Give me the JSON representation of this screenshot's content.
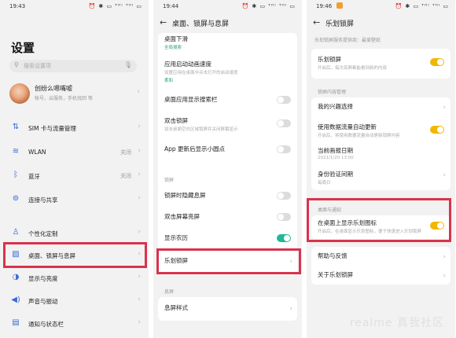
{
  "panel1": {
    "time": "19:43",
    "status_icons": "⏰ ✱ ▭ ᵀᴴᴵ ᵀᴴᴵ ▭",
    "title": "设置",
    "search_placeholder": "搜索设置项",
    "profile": {
      "name": "创纷么嗯嘴嘘",
      "sub": "帐号，云服务，手机找回 等"
    },
    "rows": [
      {
        "label": "SIM 卡与流量管理",
        "value": ""
      },
      {
        "label": "WLAN",
        "value": "关闭"
      },
      {
        "label": "蓝牙",
        "value": "关闭"
      },
      {
        "label": "连接与共享",
        "value": ""
      },
      {
        "label": "个性化定制",
        "value": ""
      },
      {
        "label": "桌面、锁屏与息屏",
        "value": ""
      },
      {
        "label": "显示与亮度",
        "value": ""
      },
      {
        "label": "声音与振动",
        "value": ""
      },
      {
        "label": "通知与状态栏",
        "value": ""
      }
    ]
  },
  "panel2": {
    "time": "19:44",
    "status_icons": "⏰ ✱ ▭ ᵀᴴᴵ ᵀᴴᴵ ▭",
    "nav_title": "桌面、锁屏与息屏",
    "items_top": [
      {
        "title": "桌面下滑",
        "desc": "全局搜索"
      },
      {
        "title": "应用启动动画速度",
        "desc": "设置应用在桌面中点击打开的启动速度",
        "value": "柔和"
      },
      {
        "title": "桌面应用显示搜索栏",
        "desc": ""
      },
      {
        "title": "双击锁屏",
        "desc": "双击桌面空白区域锁屏并关闭屏幕显示"
      },
      {
        "title": "App 更新后显示小圆点",
        "desc": ""
      }
    ],
    "section_lock": "锁屏",
    "items_lock": [
      {
        "title": "锁屏时隐藏息屏"
      },
      {
        "title": "双击屏幕亮屏"
      },
      {
        "title": "显示农历"
      },
      {
        "title": "乐划锁屏"
      }
    ],
    "section_aod": "息屏",
    "items_aod": [
      {
        "title": "息屏样式"
      }
    ]
  },
  "panel3": {
    "time": "19:46",
    "status_icons": "⏰ ✱ ▭ ᵀᴴᴵ ᵀᴴᴵ ▭",
    "nav_title": "乐划锁屏",
    "intro": "乐划锁屏服务提供商：最爱壁纸",
    "item_main": {
      "title": "乐划锁屏",
      "desc": "开启后，每次亮屏都能看到新的内容"
    },
    "section_content": "锁屏内容管理",
    "items_content": [
      {
        "title": "我的兴趣选择",
        "desc": ""
      },
      {
        "title": "使用数据流量自动更新",
        "desc": "开启后，将使用数据流量自动更新锁屏内容"
      },
      {
        "title": "当前画报日期",
        "desc": "2021/1/20 13:00"
      },
      {
        "title": "身份验证间期",
        "desc": "每周日"
      }
    ],
    "section_desktop": "桌面与通知",
    "item_desktop": {
      "title": "在桌面上显示乐划图标",
      "desc": "开启后，在桌面显示乐划图标，便于快速进入乐划锁屏"
    },
    "items_bottom": [
      {
        "title": "帮助与反馈"
      },
      {
        "title": "关于乐划锁屏"
      }
    ],
    "watermark": "realme 真我社区"
  },
  "colors": {
    "highlight": "#d8334d",
    "toggle_green": "#1fb89a",
    "toggle_yellow": "#f2b705"
  }
}
